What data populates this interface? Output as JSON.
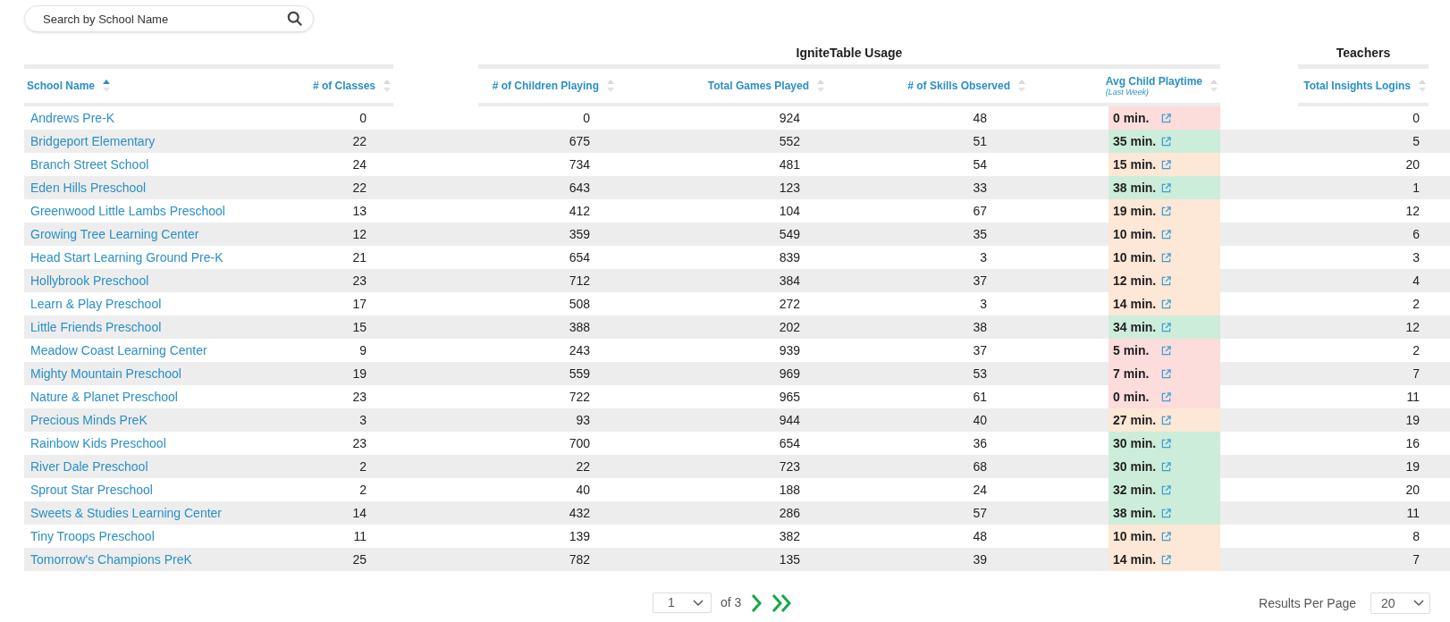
{
  "search": {
    "placeholder": "Search by School Name"
  },
  "column_groups": [
    {
      "title": "IgniteTable Usage"
    },
    {
      "title": "Teachers"
    }
  ],
  "columns": [
    {
      "label": "School Name",
      "sorted": true
    },
    {
      "label": "# of Classes",
      "sorted": false
    },
    {
      "label": "# of Children Playing",
      "sorted": false
    },
    {
      "label": "Total Games Played",
      "sorted": false
    },
    {
      "label": "# of Skills Observed",
      "sorted": false
    },
    {
      "label": "Avg Child Playtime",
      "sublabel": "(Last Week)",
      "sorted": false
    },
    {
      "label": "Total Insights Logins",
      "sorted": false
    }
  ],
  "rows": [
    {
      "school": "Andrews Pre-K",
      "classes": "0",
      "children": "0",
      "games": "924",
      "skills": "48",
      "playtime": "0 min.",
      "color": "#fddcdc",
      "logins": "0"
    },
    {
      "school": "Bridgeport Elementary",
      "classes": "22",
      "children": "675",
      "games": "552",
      "skills": "51",
      "playtime": "35 min.",
      "color": "#cdeddb",
      "logins": "5"
    },
    {
      "school": "Branch Street School",
      "classes": "24",
      "children": "734",
      "games": "481",
      "skills": "54",
      "playtime": "15 min.",
      "color": "#fde7d6",
      "logins": "20"
    },
    {
      "school": "Eden Hills Preschool",
      "classes": "22",
      "children": "643",
      "games": "123",
      "skills": "33",
      "playtime": "38 min.",
      "color": "#cdeddb",
      "logins": "1"
    },
    {
      "school": "Greenwood Little Lambs Preschool",
      "classes": "13",
      "children": "412",
      "games": "104",
      "skills": "67",
      "playtime": "19 min.",
      "color": "#fde7d6",
      "logins": "12"
    },
    {
      "school": "Growing Tree Learning Center",
      "classes": "12",
      "children": "359",
      "games": "549",
      "skills": "35",
      "playtime": "10 min.",
      "color": "#fde7d6",
      "logins": "6"
    },
    {
      "school": "Head Start Learning Ground Pre-K",
      "classes": "21",
      "children": "654",
      "games": "839",
      "skills": "3",
      "playtime": "10 min.",
      "color": "#fde7d6",
      "logins": "3"
    },
    {
      "school": "Hollybrook Preschool",
      "classes": "23",
      "children": "712",
      "games": "384",
      "skills": "37",
      "playtime": "12 min.",
      "color": "#fde7d6",
      "logins": "4"
    },
    {
      "school": "Learn & Play Preschool",
      "classes": "17",
      "children": "508",
      "games": "272",
      "skills": "3",
      "playtime": "14 min.",
      "color": "#fde7d6",
      "logins": "2"
    },
    {
      "school": "Little Friends Preschool",
      "classes": "15",
      "children": "388",
      "games": "202",
      "skills": "38",
      "playtime": "34 min.",
      "color": "#cdeddb",
      "logins": "12"
    },
    {
      "school": "Meadow Coast Learning Center",
      "classes": "9",
      "children": "243",
      "games": "939",
      "skills": "37",
      "playtime": "5 min.",
      "color": "#fddcdc",
      "logins": "2"
    },
    {
      "school": "Mighty Mountain Preschool",
      "classes": "19",
      "children": "559",
      "games": "969",
      "skills": "53",
      "playtime": "7 min.",
      "color": "#fddcdc",
      "logins": "7"
    },
    {
      "school": "Nature & Planet Preschool",
      "classes": "23",
      "children": "722",
      "games": "965",
      "skills": "61",
      "playtime": "0 min.",
      "color": "#fddcdc",
      "logins": "11"
    },
    {
      "school": "Precious Minds PreK",
      "classes": "3",
      "children": "93",
      "games": "944",
      "skills": "40",
      "playtime": "27 min.",
      "color": "#fde7d6",
      "logins": "19"
    },
    {
      "school": "Rainbow Kids Preschool",
      "classes": "23",
      "children": "700",
      "games": "654",
      "skills": "36",
      "playtime": "30 min.",
      "color": "#cdeddb",
      "logins": "16"
    },
    {
      "school": "River Dale Preschool",
      "classes": "2",
      "children": "22",
      "games": "723",
      "skills": "68",
      "playtime": "30 min.",
      "color": "#cdeddb",
      "logins": "19"
    },
    {
      "school": "Sprout Star Preschool",
      "classes": "2",
      "children": "40",
      "games": "188",
      "skills": "24",
      "playtime": "32 min.",
      "color": "#cdeddb",
      "logins": "20"
    },
    {
      "school": "Sweets & Studies Learning Center",
      "classes": "14",
      "children": "432",
      "games": "286",
      "skills": "57",
      "playtime": "38 min.",
      "color": "#cdeddb",
      "logins": "11"
    },
    {
      "school": "Tiny Troops Preschool",
      "classes": "11",
      "children": "139",
      "games": "382",
      "skills": "48",
      "playtime": "10 min.",
      "color": "#fde7d6",
      "logins": "8"
    },
    {
      "school": "Tomorrow's Champions PreK",
      "classes": "25",
      "children": "782",
      "games": "135",
      "skills": "39",
      "playtime": "14 min.",
      "color": "#fde7d6",
      "logins": "7"
    }
  ],
  "pagination": {
    "page": "1",
    "of": "of 3",
    "results_label": "Results Per Page",
    "per_page": "20"
  }
}
